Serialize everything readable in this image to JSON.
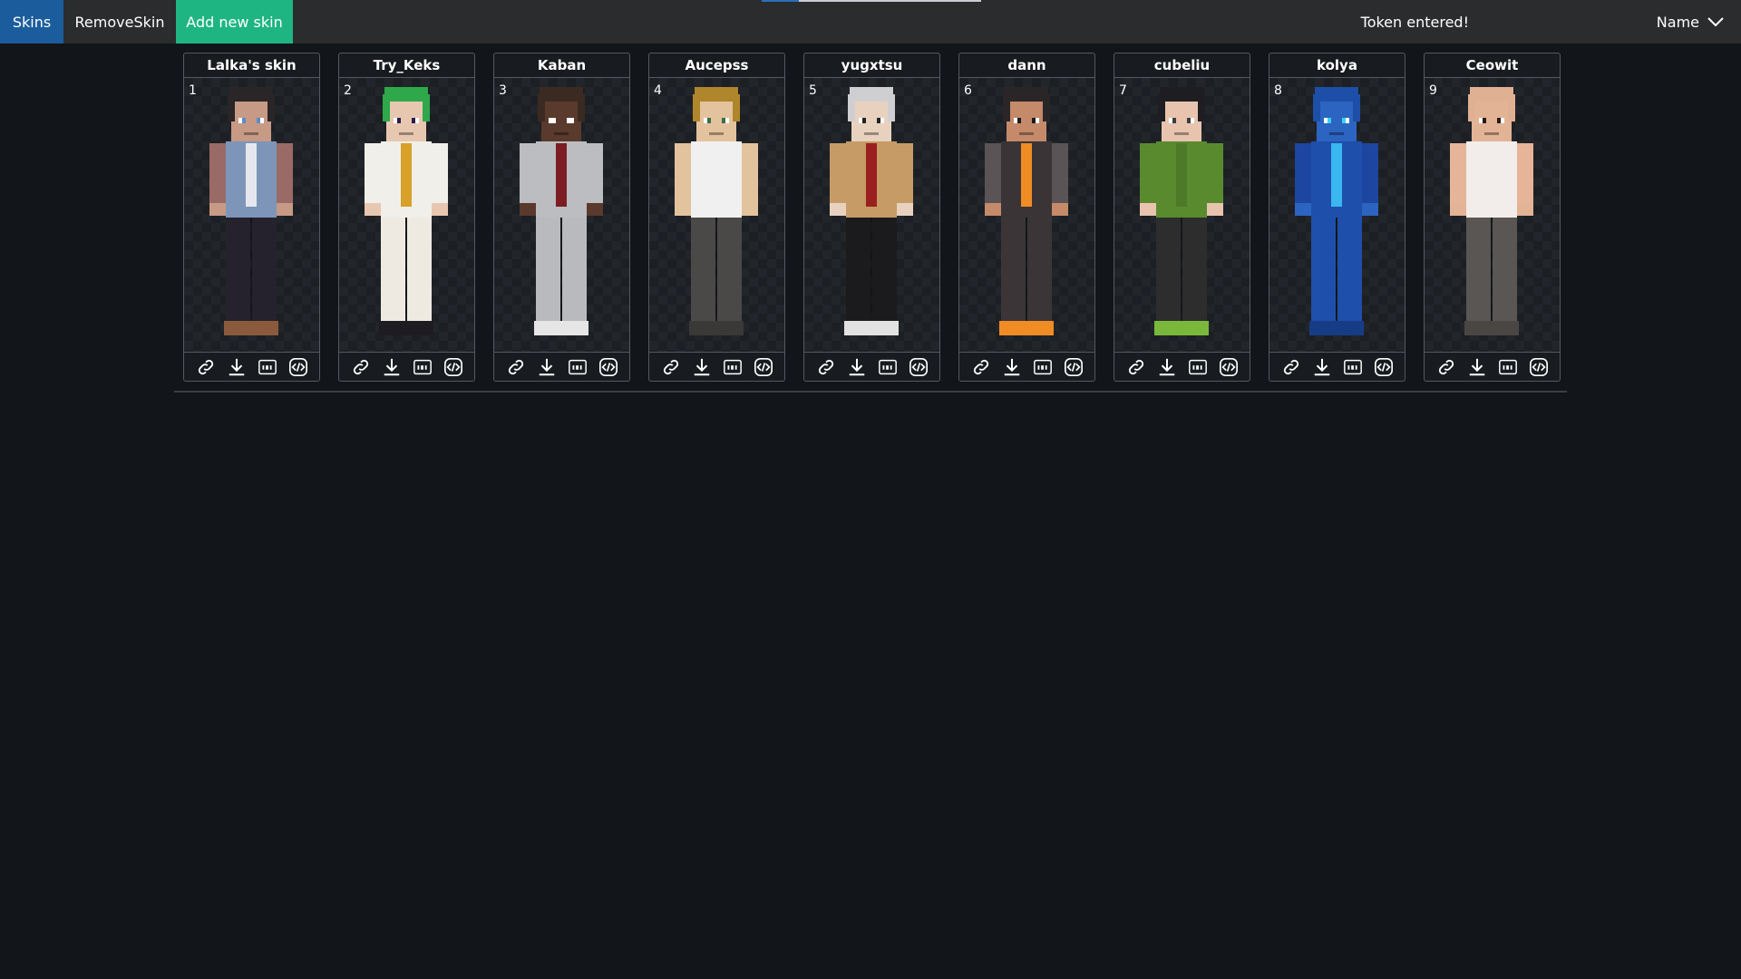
{
  "nav": {
    "skins": "Skins",
    "remove": "RemoveSkin",
    "add": "Add new skin"
  },
  "status": {
    "token": "Token entered!"
  },
  "sort": {
    "selected": "Name",
    "icon": "chevron-down-icon"
  },
  "progress": {
    "fraction": 0.17
  },
  "colors": {
    "topbar": "#2b2c2e",
    "skins_tab": "#1b5d9c",
    "add_button": "#1fb582",
    "background": "#121519",
    "card_border": "#555a60"
  },
  "action_icons": [
    "link-icon",
    "download-icon",
    "api-icon",
    "code-icon"
  ],
  "cards": [
    {
      "index": "1",
      "name": "Lalka's skin"
    },
    {
      "index": "2",
      "name": "Try_Keks"
    },
    {
      "index": "3",
      "name": "Kaban"
    },
    {
      "index": "4",
      "name": "Aucepss"
    },
    {
      "index": "5",
      "name": "yugxtsu"
    },
    {
      "index": "6",
      "name": "dann"
    },
    {
      "index": "7",
      "name": "cubeliu"
    },
    {
      "index": "8",
      "name": "kolya"
    },
    {
      "index": "9",
      "name": "Ceowit"
    }
  ]
}
